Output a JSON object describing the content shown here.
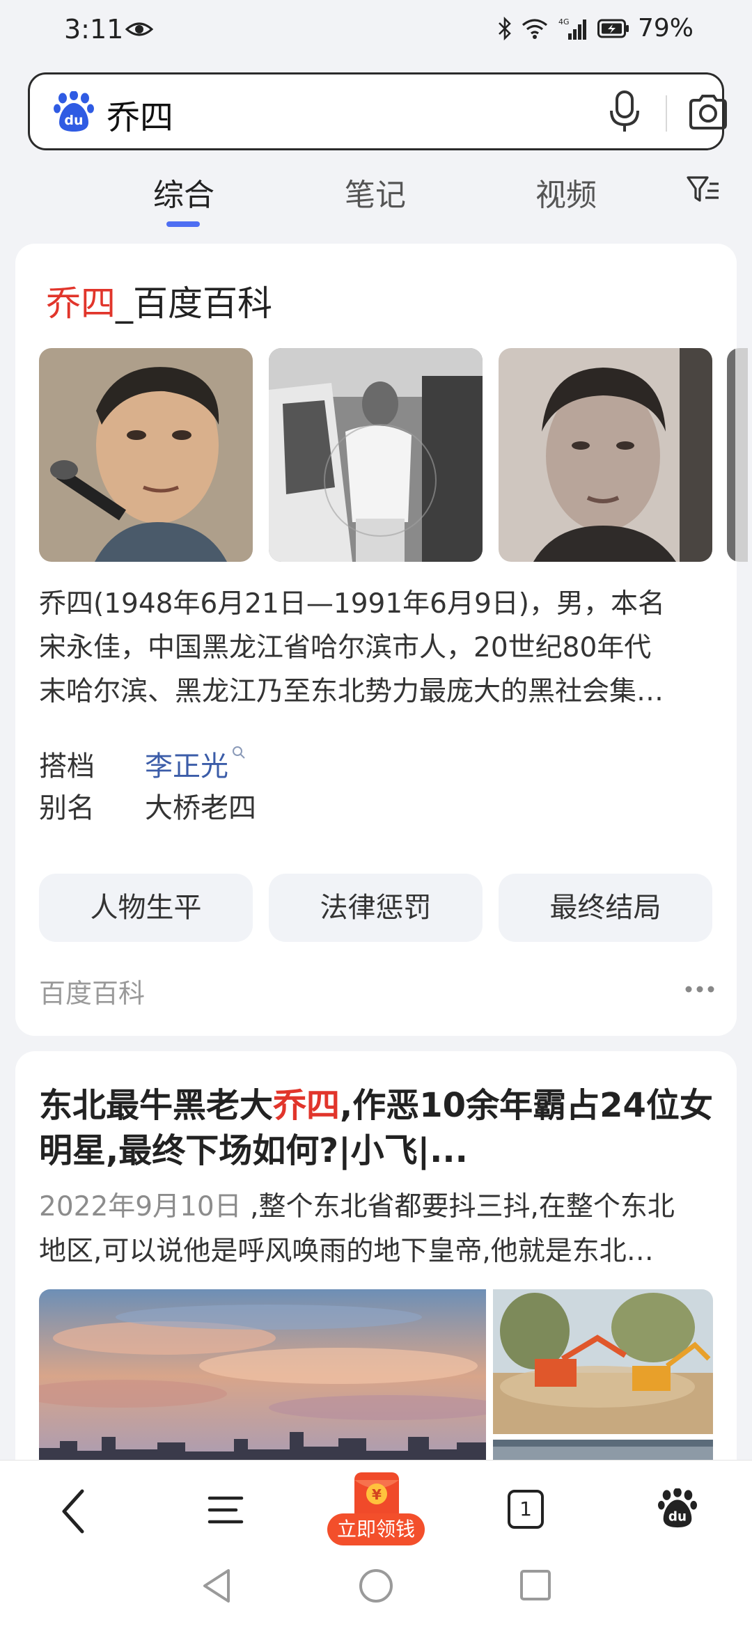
{
  "status_bar": {
    "time": "3:11",
    "battery": "79%",
    "network": "4G"
  },
  "search": {
    "query": "乔四"
  },
  "tabs": [
    {
      "label": "综合",
      "active": true
    },
    {
      "label": "笔记",
      "active": false
    },
    {
      "label": "视频",
      "active": false
    }
  ],
  "baike_card": {
    "title_highlight": "乔四",
    "title_rest": "_百度百科",
    "summary_lines": [
      "乔四(1948年6月21日—1991年6月9日)，男，本名",
      "宋永佳，中国黑龙江省哈尔滨市人，20世纪80年代",
      "末哈尔滨、黑龙江乃至东北势力最庞大的黑社会集…"
    ],
    "partner_label": "搭档",
    "partner_value": "李正光",
    "alias_label": "别名",
    "alias_value": "大桥老四",
    "pills": [
      "人物生平",
      "法律惩罚",
      "最终结局"
    ],
    "source": "百度百科"
  },
  "news_card": {
    "title_part1": "东北最牛黑老大",
    "title_highlight": "乔四",
    "title_part2": ",作恶10余年霸占24位女",
    "title_line2": "明星,最终下场如何?|小飞|...",
    "date": "2022年9月10日",
    "snippet_line1_rest": " ,整个东北省都要抖三抖,在整个东北",
    "snippet_line2": "地区,可以说他是呼风唤雨的地下皇帝,他就是东北…"
  },
  "toolbar": {
    "tab_count": "1",
    "promo_label": "立即领钱",
    "promo_icon_char": "¥"
  },
  "colors": {
    "accent": "#4e6ef2",
    "highlight": "#e1352b",
    "link": "#3b5ca8",
    "promo": "#f34f2b"
  }
}
